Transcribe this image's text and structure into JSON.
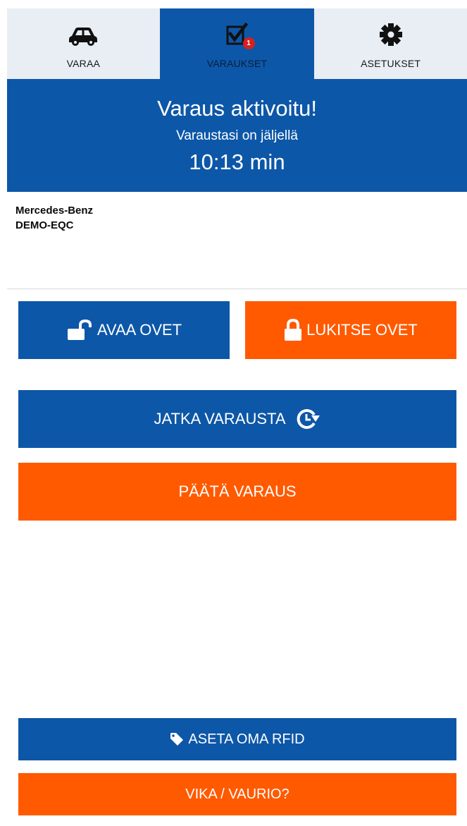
{
  "tabs": [
    {
      "label": "VARAA",
      "icon": "car-icon",
      "active": false
    },
    {
      "label": "VARAUKSET",
      "icon": "checklist-icon",
      "active": true,
      "badge": "1"
    },
    {
      "label": "ASETUKSET",
      "icon": "gear-icon",
      "active": false
    }
  ],
  "banner": {
    "title": "Varaus aktivoitu!",
    "subtitle": "Varaustasi on jäljellä",
    "timer": "10:13 min"
  },
  "vehicle": {
    "make": "Mercedes-Benz",
    "plate": "DEMO-EQC"
  },
  "actions": {
    "open_doors": "AVAA OVET",
    "lock_doors": "LUKITSE OVET",
    "extend": "JATKA VARAUSTA",
    "end": "PÄÄTÄ VARAUS",
    "rfid": "ASETA OMA RFID",
    "fault": "VIKA / VAURIO?"
  },
  "colors": {
    "primary_blue": "#0d57a8",
    "accent_orange": "#ff5a00",
    "tab_inactive": "#e8eef4",
    "badge_red": "#d62020"
  }
}
